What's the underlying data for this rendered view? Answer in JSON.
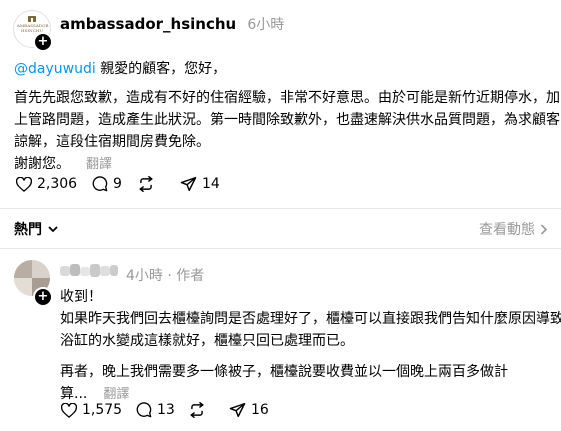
{
  "post": {
    "username": "ambassador_hsinchu",
    "time": "6小時",
    "avatar_text": "AMBASSADOR",
    "avatar_subtext": "HSINCHU",
    "mention": "@dayuwudi",
    "greeting": " 親愛的顧客，您好，",
    "paragraph_lines": [
      "首先先跟您致歉，造成有不好的住宿經驗，非常不好意思。由於可能是新竹近期停水，加",
      "上管路問題，造成產生此狀況。第一時間除致歉外，也盡速解決供水品質問題，為求顧客",
      "諒解，這段住宿期間房費免除。"
    ],
    "thanks": "謝謝您。",
    "translate": "翻譯",
    "likes": "2,306",
    "comments": "9",
    "reposts": "",
    "shares": "14"
  },
  "replies_bar": {
    "label": "熱門",
    "view_activity": "查看動態"
  },
  "reply": {
    "time": "4小時",
    "author_tag": "作者",
    "lines": [
      "收到！",
      "如果昨天我們回去櫃檯詢問是否處理好了，櫃檯可以直接跟我們告知什麼原因導致",
      "浴缸的水變成這樣就好，櫃檯只回已處理而已。",
      "再者，晚上我們需要多一條被子，櫃檯說要收費並以一個晚上兩百多做計",
      "算..."
    ],
    "translate": "翻譯",
    "likes": "1,575",
    "comments": "13",
    "reposts": "",
    "shares": "16"
  },
  "colors": {
    "mention": "#0095f6",
    "secondary": "#999999"
  }
}
